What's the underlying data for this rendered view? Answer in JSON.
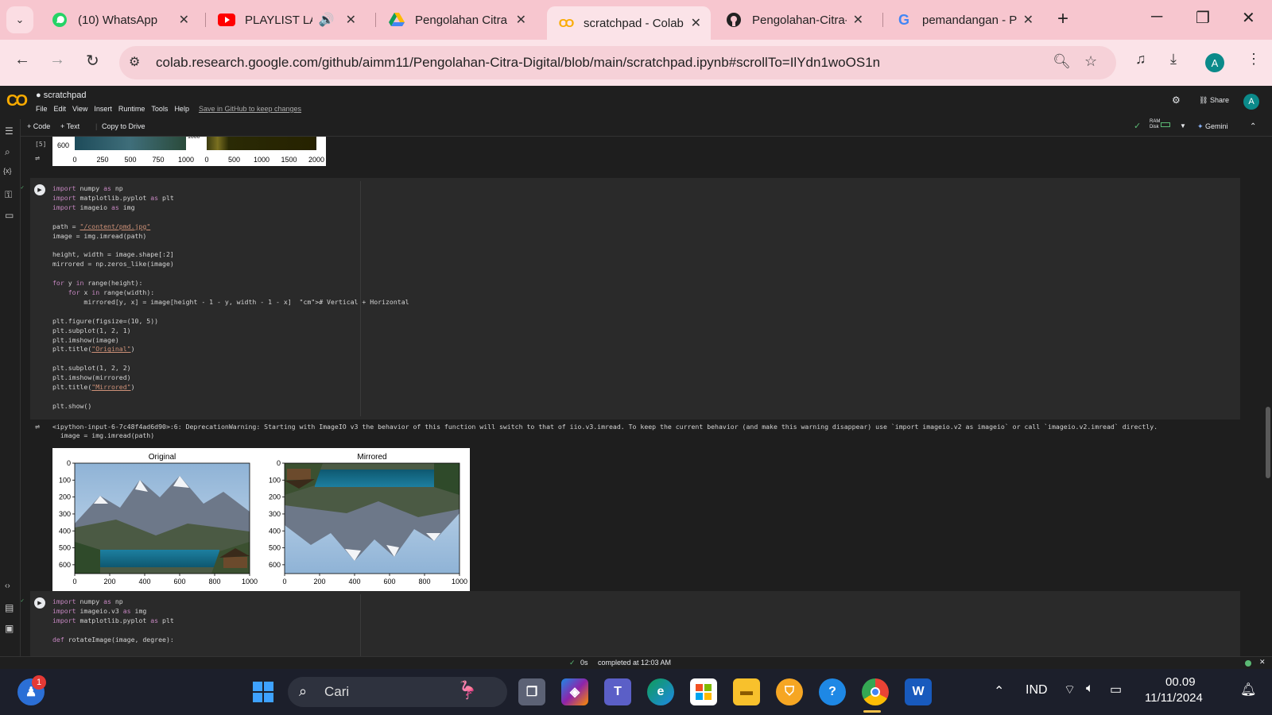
{
  "browser": {
    "tabs": [
      {
        "label": "(10) WhatsApp",
        "icon": "whatsapp-icon"
      },
      {
        "label": "PLAYLIST LAGU",
        "icon": "youtube-icon"
      },
      {
        "label": "Pengolahan Citra D",
        "icon": "google-drive-icon"
      },
      {
        "label": "scratchpad - Colab",
        "icon": "colab-icon",
        "active": true
      },
      {
        "label": "Pengolahan-Citra-D",
        "icon": "github-icon"
      },
      {
        "label": "pemandangan - Pe",
        "icon": "google-icon"
      }
    ],
    "url": "colab.research.google.com/github/aimm11/Pengolahan-Citra-Digital/blob/main/scratchpad.ipynb#scrollTo=IlYdn1woOS1n",
    "avatar_letter": "A"
  },
  "colab": {
    "logo": "CO",
    "title": "scratchpad",
    "menu": [
      "File",
      "Edit",
      "View",
      "Insert",
      "Runtime",
      "Tools",
      "Help"
    ],
    "save_link": "Save in GitHub to keep changes",
    "share": "Share",
    "avatar_letter": "A",
    "toolbar": {
      "code": "+ Code",
      "text": "+ Text",
      "copy": "Copy to Drive",
      "ram": "RAM",
      "disk": "Disk",
      "gemini": "Gemini"
    }
  },
  "cells": {
    "prev_output": {
      "exec": "[5]",
      "ytick": "600",
      "xticks_left": [
        "0",
        "250",
        "500",
        "750",
        "1000"
      ],
      "xticks_right": [
        "0",
        "500",
        "1000",
        "1500",
        "2000"
      ],
      "clipped_label": "1000"
    },
    "cell6": {
      "lines": [
        "import numpy as np",
        "import matplotlib.pyplot as plt",
        "import imageio as img",
        "",
        "path = \"/content/pmd.jpg\"",
        "image = img.imread(path)",
        "",
        "height, width = image.shape[:2]",
        "mirrored = np.zeros_like(image)",
        "",
        "for y in range(height):",
        "    for x in range(width):",
        "        mirrored[y, x] = image[height - 1 - y, width - 1 - x]  # Vertical + Horizontal",
        "",
        "plt.figure(figsize=(10, 5))",
        "plt.subplot(1, 2, 1)",
        "plt.imshow(image)",
        "plt.title(\"Original\")",
        "",
        "plt.subplot(1, 2, 2)",
        "plt.imshow(mirrored)",
        "plt.title(\"Mirrored\")",
        "",
        "plt.show()"
      ],
      "warning_line1": "<ipython-input-6-7c48f4ad6d90>:6: DeprecationWarning: Starting with ImageIO v3 the behavior of this function will switch to that of iio.v3.imread. To keep the current behavior (and make this warning disappear) use `import imageio.v2 as imageio` or call `imageio.v2.imread` directly.",
      "warning_line2": "  image = img.imread(path)",
      "plots": [
        {
          "title": "Original",
          "yticks": [
            "0",
            "100",
            "200",
            "300",
            "400",
            "500",
            "600"
          ],
          "xticks": [
            "0",
            "200",
            "400",
            "600",
            "800",
            "1000"
          ]
        },
        {
          "title": "Mirrored",
          "yticks": [
            "0",
            "100",
            "200",
            "300",
            "400",
            "500",
            "600"
          ],
          "xticks": [
            "0",
            "200",
            "400",
            "600",
            "800",
            "1000"
          ]
        }
      ]
    },
    "cell7": {
      "lines": [
        "import numpy as np",
        "import imageio.v3 as img",
        "import matplotlib.pyplot as plt",
        "",
        "def rotateImage(image, degree):"
      ]
    }
  },
  "status": {
    "time": "0s",
    "text": "completed at 12:03 AM"
  },
  "taskbar": {
    "search_placeholder": "Cari",
    "language": "IND",
    "clock_time": "00.09",
    "clock_date": "11/11/2024",
    "notification_badge": "1"
  }
}
